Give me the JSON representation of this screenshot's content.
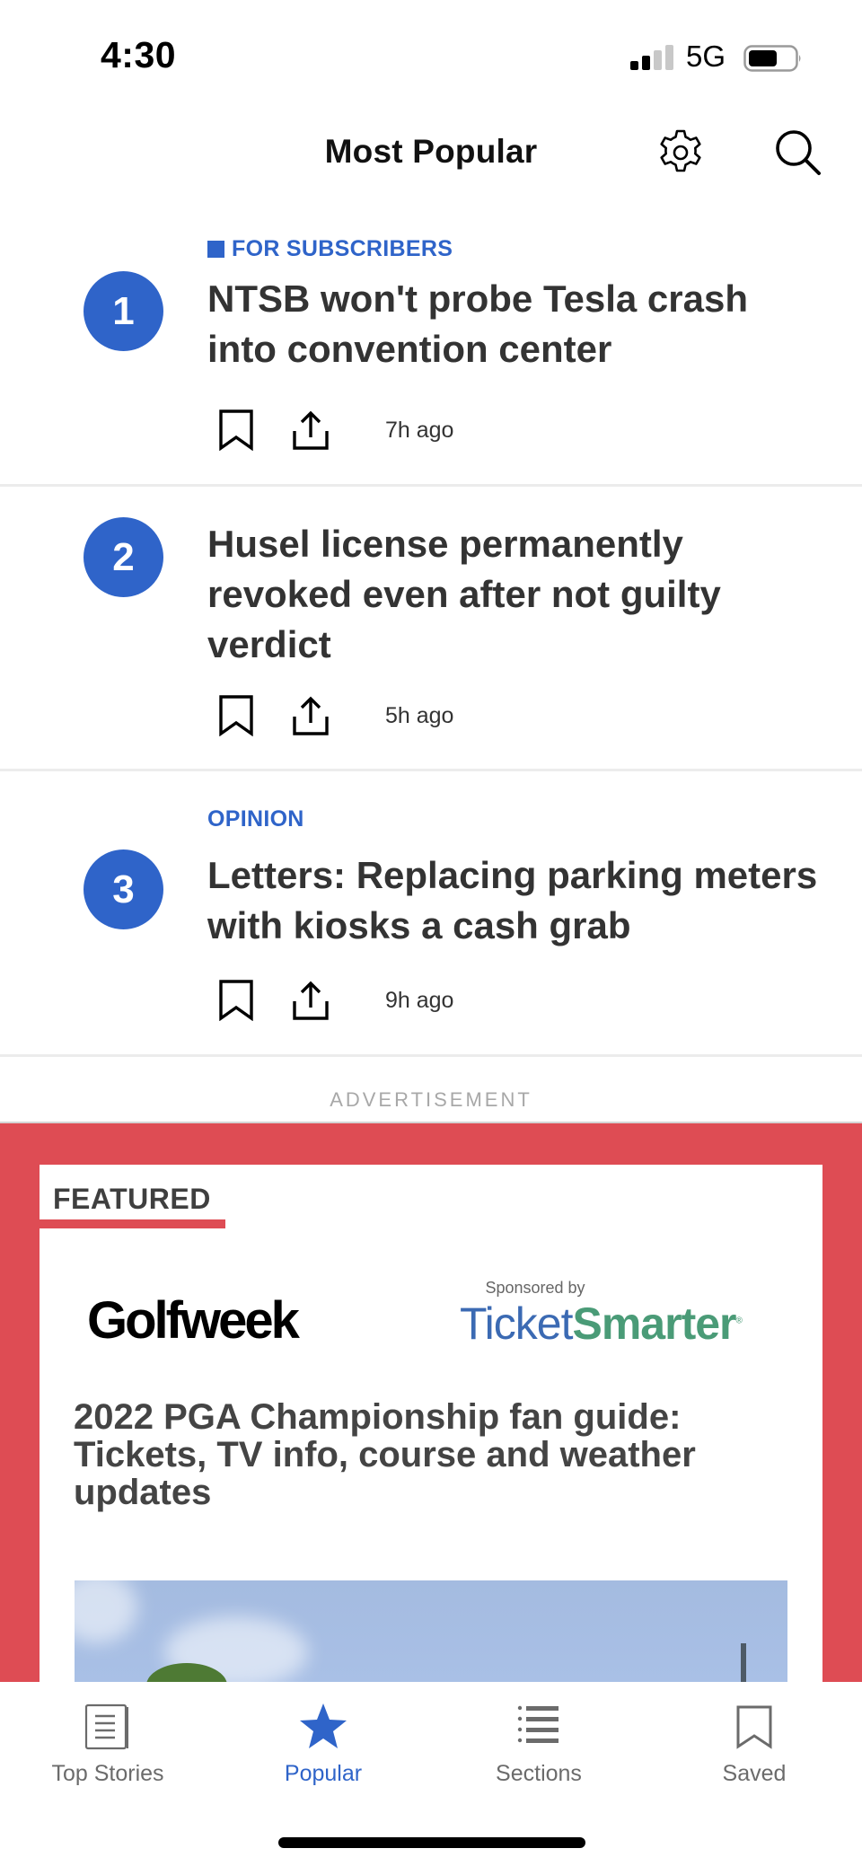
{
  "status_bar": {
    "time": "4:30",
    "network": "5G",
    "signal_bars_filled": 2,
    "signal_bars_total": 4,
    "battery_level_percent": 60
  },
  "header": {
    "title": "Most Popular",
    "icons": [
      "gear-icon",
      "search-icon"
    ]
  },
  "articles": [
    {
      "rank": "1",
      "label": "FOR SUBSCRIBERS",
      "label_has_square": true,
      "headline": "NTSB won't probe Tesla crash into convention center",
      "time": "7h ago"
    },
    {
      "rank": "2",
      "label": "",
      "headline": "Husel license permanently revoked even after not guilty verdict",
      "time": "5h ago"
    },
    {
      "rank": "3",
      "label": "OPINION",
      "headline": "Letters: Replacing parking meters with kiosks a cash grab",
      "time": "9h ago"
    }
  ],
  "advertisement": {
    "label": "ADVERTISEMENT",
    "featured_label": "FEATURED",
    "brand_logo": "Golfweek",
    "sponsored_by": "Sponsored by",
    "sponsor_part1": "Ticket",
    "sponsor_part2": "Smarter",
    "headline": "2022 PGA Championship fan guide: Tickets, TV info, course and weather updates"
  },
  "tabbar": {
    "tabs": [
      {
        "label": "Top Stories",
        "icon": "newspaper-icon",
        "active": false
      },
      {
        "label": "Popular",
        "icon": "star-icon",
        "active": true
      },
      {
        "label": "Sections",
        "icon": "list-icon",
        "active": false
      },
      {
        "label": "Saved",
        "icon": "bookmark-icon",
        "active": false
      }
    ]
  },
  "colors": {
    "accent_blue": "#2f64c9",
    "ad_red": "#de4c54",
    "text_dark": "#333333",
    "tab_inactive": "#6b6b6b"
  }
}
